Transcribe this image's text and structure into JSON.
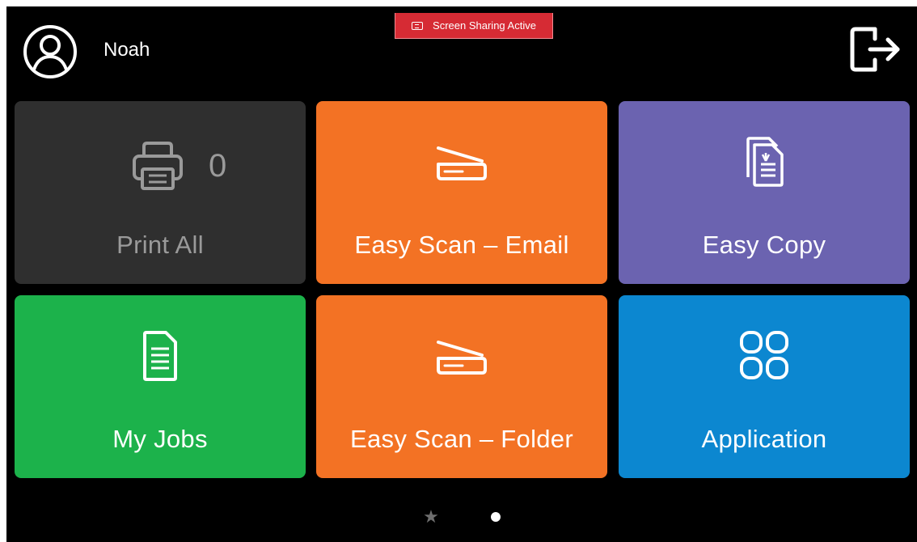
{
  "banner": {
    "text": "Screen Sharing Active",
    "icon": "screen-share-icon",
    "color": "#d62b34"
  },
  "user": {
    "name": "Noah",
    "avatar_icon": "user-circle-icon"
  },
  "header": {
    "logout_icon": "logout-icon"
  },
  "tiles": {
    "print_all": {
      "label": "Print All",
      "count": "0",
      "icon": "printer-icon",
      "color": "#2f2f2f"
    },
    "easy_scan_email": {
      "label": "Easy Scan – Email",
      "icon": "scanner-icon",
      "color": "#f37224"
    },
    "easy_copy": {
      "label": "Easy Copy",
      "icon": "copy-document-icon",
      "color": "#6b63b0"
    },
    "my_jobs": {
      "label": "My Jobs",
      "icon": "document-icon",
      "color": "#1cb24b"
    },
    "easy_scan_folder": {
      "label": "Easy Scan – Folder",
      "icon": "scanner-icon",
      "color": "#f37224"
    },
    "application": {
      "label": "Application",
      "icon": "apps-grid-icon",
      "color": "#0c87d0"
    }
  },
  "pager": {
    "favorites_icon": "star-icon",
    "pages": 1,
    "current": 1
  }
}
